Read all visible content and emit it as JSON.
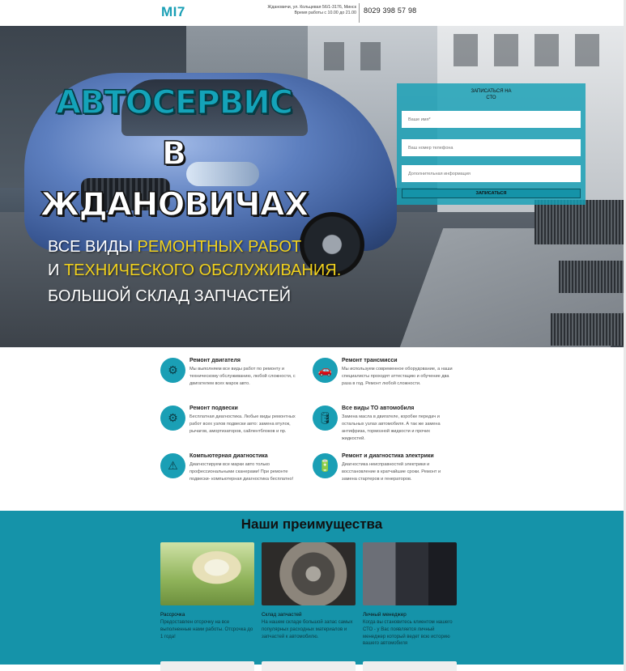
{
  "header": {
    "logo": "MI7",
    "address_line1": "Ждановичи, ул. Кольцевая 56/1-3176, Минск",
    "address_line2": "Время работы с 10.00 до 21.00",
    "phone": "8029 398 57 98"
  },
  "hero": {
    "title_line1": "АВТОСЕРВИС",
    "title_line2": "В",
    "title_line3": "ЖДАНОВИЧАХ",
    "sub1_a": "ВСЕ ВИДЫ ",
    "sub1_b": "РЕМОНТНЫХ РАБОТ",
    "sub2_a": "И ",
    "sub2_b": "ТЕХНИЧЕСКОГО ОБСЛУЖИВАНИЯ.",
    "sub3": "БОЛЬШОЙ СКЛАД ЗАПЧАСТЕЙ"
  },
  "form": {
    "title_line1": "ЗАПИСАТЬСЯ НА",
    "title_line2": "СТО",
    "name_placeholder": "Ваше имя*",
    "phone_placeholder": "Ваш номер телефона",
    "info_placeholder": "Дополнительная информация",
    "submit_label": "ЗАПИСАТЬСЯ"
  },
  "services": [
    {
      "icon": "engine-icon",
      "name": "Ремонт двигателя",
      "desc": "Мы выполняем все виды работ по ремонту и техническому обслуживанию, любой сложности, с двигателем всех марок авто."
    },
    {
      "icon": "car-icon",
      "name": "Ремонт трансмисси",
      "desc": "Мы используем современное оборудование, а наши специалисты проходят аттестацию и обучение два раза в год. Ремонт любой сложности."
    },
    {
      "icon": "suspension-icon",
      "name": "Ремонт подвески",
      "desc": "Бесплатная диагностика. Любые виды ремонтных работ всех узлов подвески авто: замена втулок, рычагов, амортизаторов, сайлентблоков и пр."
    },
    {
      "icon": "oil-can-icon",
      "name": "Все виды ТО автомобиля",
      "desc": "Замена масла в двигателе, коробке передач и остальных узлах автомобиля. А так же замена антифриза, тормозной жидкости и прочих жидкостей."
    },
    {
      "icon": "warning-icon",
      "name": "Компьютерная диагностика",
      "desc": "Диагностируем все марки авто только профессиональными сканерами! При ремонте подвески- компьютерная диагностика бесплатно!"
    },
    {
      "icon": "battery-icon",
      "name": "Ремонт и диагностика электрики",
      "desc": "Диагностика неисправностей электрики и восстановление в кратчайшие сроки. Ремонт и замена стартеров и генераторов."
    }
  ],
  "advantages": {
    "title": "Наши преимущества",
    "cards": [
      {
        "title": "Рассрочка",
        "text": "Предоставлен отсрочку на все выполненные нами работы. Отсрочка до 1 года!"
      },
      {
        "title": "Склад запчастей",
        "text": "На нашем складе большой запас самых популярных расходных материалов и запчастей к автомобилю."
      },
      {
        "title": "Личный менеджер",
        "text": "Когда вы становитесь клиентом нашего СТО - у Вас появляется личный менеджер который ведет всю историю вашего автомобиля"
      }
    ]
  }
}
